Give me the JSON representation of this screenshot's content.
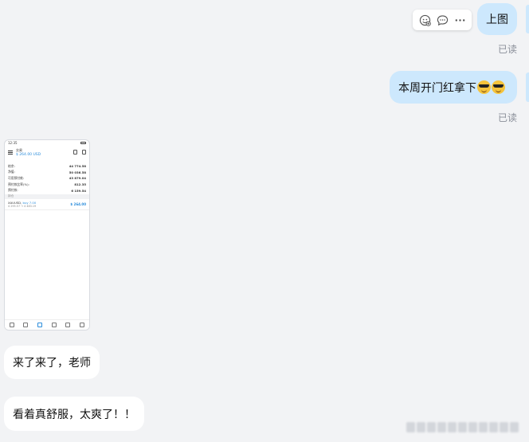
{
  "messages": {
    "out1": {
      "text": "上图",
      "status": "已读"
    },
    "out2": {
      "text": "本周开门红拿下",
      "emojis": [
        "sunglasses-emoji",
        "sunglasses-emoji"
      ],
      "status": "已读"
    },
    "in1": {
      "text": "来了来了，老师"
    },
    "in2": {
      "text": "看着真舒服，太爽了！！"
    }
  },
  "actions": {
    "icons": [
      "emoji-reaction-icon",
      "comment-icon",
      "more-icon"
    ]
  },
  "phone": {
    "status_time": "12:35",
    "title": "交易",
    "balance_line": "$ 264.00 USD",
    "rows": [
      {
        "label": "结余:",
        "value": "44 774.58"
      },
      {
        "label": "净值:",
        "value": "50 036.58"
      },
      {
        "label": "可用预付款:",
        "value": "43 879.04"
      },
      {
        "label": "预付款比率(%):",
        "value": "812.35"
      },
      {
        "label": "预付款:",
        "value": "6 159.54"
      }
    ],
    "section": "持仓",
    "position": {
      "symbol": "XAUUSD,",
      "side": "buy 7.00",
      "range": "4 295.57 → 4 483.19",
      "profit": "$ 264.00"
    }
  },
  "colors": {
    "outgoing_bubble": "#cde8fd",
    "incoming_bubble": "#ffffff",
    "background": "#f2f3f5",
    "read_text": "#8a8f99",
    "accent": "#2c8ddb"
  }
}
